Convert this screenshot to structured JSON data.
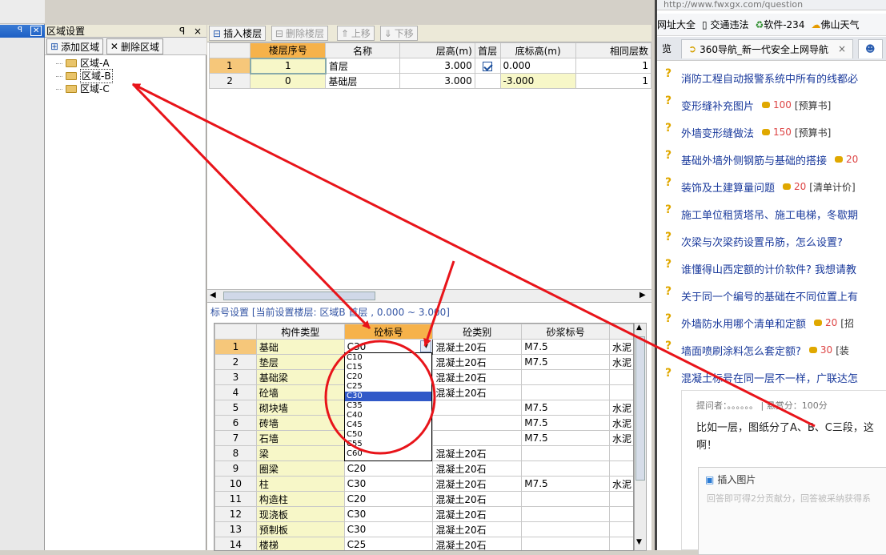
{
  "left_strip": {
    "pin": "ꟼ",
    "close": "✕"
  },
  "area_panel": {
    "title": "区域设置",
    "pin": "ꟼ",
    "close": "×",
    "add_label": "添加区域",
    "delete_label": "删除区域",
    "tree": [
      "区域-A",
      "区域-B",
      "区域-C"
    ]
  },
  "floor": {
    "toolbar": {
      "insert": "插入楼层",
      "delete": "删除楼层",
      "up": "上移",
      "down": "下移"
    },
    "headers": [
      "",
      "楼层序号",
      "名称",
      "层高(m)",
      "首层",
      "底标高(m)",
      "相同层数"
    ],
    "rows": [
      {
        "n": "1",
        "seq": "1",
        "name": "首层",
        "height": "3.000",
        "first": true,
        "elev": "0.000",
        "same": "1"
      },
      {
        "n": "2",
        "seq": "0",
        "name": "基础层",
        "height": "3.000",
        "first": false,
        "elev": "-3.000",
        "same": "1"
      }
    ]
  },
  "label": {
    "title": "标号设置 [当前设置楼层: 区域B 首层 , 0.000 ~ 3.000]",
    "headers": [
      "",
      "构件类型",
      "砼标号",
      "砼类别",
      "砂浆标号",
      ""
    ],
    "rows": [
      {
        "n": "1",
        "type": "基础",
        "grade": "C30",
        "cat": "混凝土20石",
        "mortar": "M7.5",
        "extra": "水泥"
      },
      {
        "n": "2",
        "type": "垫层",
        "grade": "",
        "cat": "混凝土20石",
        "mortar": "M7.5",
        "extra": "水泥"
      },
      {
        "n": "3",
        "type": "基础梁",
        "grade": "",
        "cat": "混凝土20石",
        "mortar": "",
        "extra": ""
      },
      {
        "n": "4",
        "type": "砼墙",
        "grade": "",
        "cat": "混凝土20石",
        "mortar": "",
        "extra": ""
      },
      {
        "n": "5",
        "type": "砌块墙",
        "grade": "",
        "cat": "",
        "mortar": "M7.5",
        "extra": "水泥"
      },
      {
        "n": "6",
        "type": "砖墙",
        "grade": "",
        "cat": "",
        "mortar": "M7.5",
        "extra": "水泥"
      },
      {
        "n": "7",
        "type": "石墙",
        "grade": "",
        "cat": "",
        "mortar": "M7.5",
        "extra": "水泥"
      },
      {
        "n": "8",
        "type": "梁",
        "grade": "",
        "cat": "混凝土20石",
        "mortar": "",
        "extra": ""
      },
      {
        "n": "9",
        "type": "圈梁",
        "grade": "C20",
        "cat": "混凝土20石",
        "mortar": "",
        "extra": ""
      },
      {
        "n": "10",
        "type": "柱",
        "grade": "C30",
        "cat": "混凝土20石",
        "mortar": "M7.5",
        "extra": "水泥"
      },
      {
        "n": "11",
        "type": "构造柱",
        "grade": "C20",
        "cat": "混凝土20石",
        "mortar": "",
        "extra": ""
      },
      {
        "n": "12",
        "type": "现浇板",
        "grade": "C30",
        "cat": "混凝土20石",
        "mortar": "",
        "extra": ""
      },
      {
        "n": "13",
        "type": "预制板",
        "grade": "C30",
        "cat": "混凝土20石",
        "mortar": "",
        "extra": ""
      },
      {
        "n": "14",
        "type": "楼梯",
        "grade": "C25",
        "cat": "混凝土20石",
        "mortar": "",
        "extra": ""
      }
    ],
    "dropdown": [
      "C10",
      "C15",
      "C20",
      "C25",
      "C30",
      "C35",
      "C40",
      "C45",
      "C50",
      "C55",
      "C60"
    ],
    "dropdown_selected": "C30"
  },
  "browser": {
    "url": "http://www.fwxgx.com/question",
    "favorites": [
      "网址大全",
      "交通违法",
      "软件-234",
      "佛山天气"
    ],
    "tabs": [
      "览",
      "360导航_新一代安全上网导航"
    ],
    "questions": [
      {
        "title": "消防工程自动报警系统中所有的线都必",
        "score": "",
        "tag": ""
      },
      {
        "title": "变形缝补充图片",
        "score": "100",
        "tag": "[预算书]"
      },
      {
        "title": "外墙变形缝做法",
        "score": "150",
        "tag": "[预算书]"
      },
      {
        "title": "基础外墙外侧钢筋与基础的搭接",
        "score": "20",
        "tag": ""
      },
      {
        "title": "装饰及土建算量问题",
        "score": "20",
        "tag": "[清单计价]"
      },
      {
        "title": "施工单位租赁塔吊、施工电梯，冬歇期",
        "score": "",
        "tag": ""
      },
      {
        "title": "次梁与次梁药设置吊筋，怎么设置?",
        "score": "",
        "tag": ""
      },
      {
        "title": "谁懂得山西定额的计价软件? 我想请教",
        "score": "",
        "tag": ""
      },
      {
        "title": "关于同一个编号的基础在不同位置上有",
        "score": "",
        "tag": ""
      },
      {
        "title": "外墙防水用哪个清单和定额",
        "score": "20",
        "tag": "[招"
      },
      {
        "title": "墙面喷刷涂料怎么套定额?",
        "score": "30",
        "tag": "[装"
      },
      {
        "title": "混凝土标号在同一层不一样，广联达怎",
        "score": "",
        "tag": ""
      }
    ],
    "asker": "提问者：。。。。。。  |  悬赏分：100分",
    "body": "比如一层，图纸分了A、B、C三段，这啊！",
    "insert_image": "插入图片",
    "placeholder": "回答即可得2分贡献分，回答被采纳获得系"
  },
  "colors": {
    "annotation": "#e8141a",
    "header_highlight": "#f6b24a",
    "yellow_cell": "#f7f7c8",
    "selected_blue": "#3159c8"
  }
}
